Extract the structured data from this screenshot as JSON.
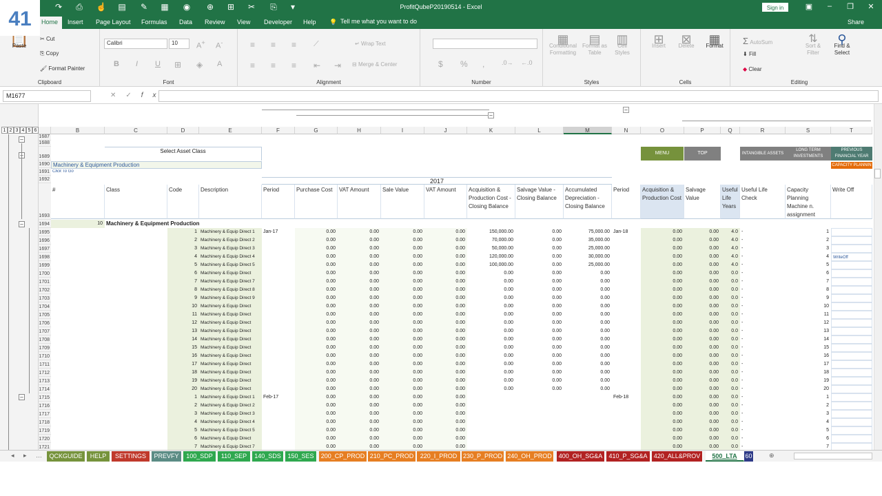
{
  "window": {
    "title": "ProfitQubeP20190514 - Excel",
    "signin": "Sign in"
  },
  "badge": "41",
  "ribbon_tabs": [
    "Home",
    "Insert",
    "Page Layout",
    "Formulas",
    "Data",
    "Review",
    "View",
    "Developer",
    "Help"
  ],
  "tellme": "Tell me what you want to do",
  "share": "Share",
  "ribbon": {
    "clipboard": {
      "label": "Clipboard",
      "paste": "Paste",
      "cut": "Cut",
      "copy": "Copy",
      "format_painter": "Format Painter"
    },
    "font": {
      "label": "Font",
      "family": "Calibri",
      "size": "10",
      "bold": "B",
      "italic": "I",
      "underline": "U"
    },
    "alignment": {
      "label": "Alignment",
      "wrap": "Wrap Text",
      "merge": "Merge & Center"
    },
    "number": {
      "label": "Number",
      "currency": "$",
      "percent": "%"
    },
    "styles": {
      "label": "Styles",
      "cond": "Conditional Formatting",
      "table": "Format as Table",
      "cell": "Cell Styles"
    },
    "cells": {
      "label": "Cells",
      "insert": "Insert",
      "delete": "Delete",
      "format": "Format"
    },
    "editing": {
      "label": "Editing",
      "autosum": "AutoSum",
      "fill": "Fill",
      "clear": "Clear",
      "sort": "Sort & Filter",
      "find": "Find & Select"
    }
  },
  "formula_bar": {
    "name_box": "M1677",
    "value": ""
  },
  "columns": [
    "B",
    "C",
    "D",
    "E",
    "F",
    "G",
    "H",
    "I",
    "J",
    "K",
    "L",
    "M",
    "N",
    "O",
    "P",
    "Q",
    "R",
    "S",
    "T"
  ],
  "outline_levels_v": [
    "1",
    "2",
    "3"
  ],
  "outline_levels_h": [
    "1",
    "2",
    "3",
    "4",
    "5",
    "6"
  ],
  "sheet": {
    "select_asset_class": "Select Asset Class",
    "asset_class": "Machinery & Equipment Production",
    "click_to_go": "Click To Go",
    "year": "2017",
    "buttons": {
      "menu": "MENU",
      "top": "TOP",
      "intangible": "INTANGIBLE ASSETS",
      "long_term": "LONG TERM INVESTMENTS",
      "prev_fy": "PREVIOUS FINANCIAL YEAR",
      "capacity": "CAPACITY PLANNIN"
    },
    "headers": {
      "hash": "#",
      "class": "Class",
      "code": "Code",
      "description": "Description",
      "period": "Period",
      "purchase_cost": "Purchase Cost",
      "vat1": "VAT Amount",
      "sale_value": "Sale Value",
      "vat2": "VAT Amount",
      "acq_closing": "Acquisition & Production Cost - Closing Balance",
      "salvage_closing": "Salvage Value - Closing Balance",
      "accum_dep": "Accumulated Depreciation - Closing Balance",
      "period2": "Period",
      "acq_cost": "Acquisition & Production Cost",
      "salvage": "Salvage Value",
      "useful_life": "Useful Life Years",
      "useful_check": "Useful Life Check",
      "capacity": "Capacity Planning Machine n. assignment",
      "writeoff": "Write Off"
    },
    "group_row": {
      "row": "1694",
      "num": "10",
      "label": "Machinery & Equipment Production"
    },
    "row_numbers_top": [
      "1687",
      "1688",
      "1689",
      "1690",
      "1691",
      "1692",
      "1693"
    ],
    "rows": [
      {
        "r": "1695",
        "code": "1",
        "desc": "Machinery & Equip Direct 1",
        "period": "Jan-17",
        "g": "0.00",
        "h": "0.00",
        "i": "0.00",
        "j": "0.00",
        "k": "150,000.00",
        "l": "0.00",
        "m": "75,000.00",
        "n": "Jan-18",
        "o": "0.00",
        "p": "0.00",
        "q": "4.0",
        "r2": "-",
        "s": "1",
        "t": ""
      },
      {
        "r": "1696",
        "code": "2",
        "desc": "Machinery & Equip Direct 2",
        "period": "",
        "g": "0.00",
        "h": "0.00",
        "i": "0.00",
        "j": "0.00",
        "k": "70,000.00",
        "l": "0.00",
        "m": "35,000.00",
        "n": "",
        "o": "0.00",
        "p": "0.00",
        "q": "4.0",
        "r2": "-",
        "s": "2",
        "t": ""
      },
      {
        "r": "1697",
        "code": "3",
        "desc": "Machinery & Equip Direct 3",
        "period": "",
        "g": "0.00",
        "h": "0.00",
        "i": "0.00",
        "j": "0.00",
        "k": "50,000.00",
        "l": "0.00",
        "m": "25,000.00",
        "n": "",
        "o": "0.00",
        "p": "0.00",
        "q": "4.0",
        "r2": "-",
        "s": "3",
        "t": ""
      },
      {
        "r": "1698",
        "code": "4",
        "desc": "Machinery & Equip Direct 4",
        "period": "",
        "g": "0.00",
        "h": "0.00",
        "i": "0.00",
        "j": "0.00",
        "k": "120,000.00",
        "l": "0.00",
        "m": "30,000.00",
        "n": "",
        "o": "0.00",
        "p": "0.00",
        "q": "4.0",
        "r2": "-",
        "s": "4",
        "t": "WriteOff"
      },
      {
        "r": "1699",
        "code": "5",
        "desc": "Machinery & Equip Direct 5",
        "period": "",
        "g": "0.00",
        "h": "0.00",
        "i": "0.00",
        "j": "0.00",
        "k": "100,000.00",
        "l": "0.00",
        "m": "25,000.00",
        "n": "",
        "o": "0.00",
        "p": "0.00",
        "q": "4.0",
        "r2": "-",
        "s": "5",
        "t": ""
      },
      {
        "r": "1700",
        "code": "6",
        "desc": "Machinery & Equip Direct",
        "period": "",
        "g": "0.00",
        "h": "0.00",
        "i": "0.00",
        "j": "0.00",
        "k": "0.00",
        "l": "0.00",
        "m": "0.00",
        "n": "",
        "o": "0.00",
        "p": "0.00",
        "q": "0.0",
        "r2": "-",
        "s": "6",
        "t": ""
      },
      {
        "r": "1701",
        "code": "7",
        "desc": "Machinery & Equip Direct 7",
        "period": "",
        "g": "0.00",
        "h": "0.00",
        "i": "0.00",
        "j": "0.00",
        "k": "0.00",
        "l": "0.00",
        "m": "0.00",
        "n": "",
        "o": "0.00",
        "p": "0.00",
        "q": "0.0",
        "r2": "-",
        "s": "7",
        "t": ""
      },
      {
        "r": "1702",
        "code": "8",
        "desc": "Machinery & Equip Direct 8",
        "period": "",
        "g": "0.00",
        "h": "0.00",
        "i": "0.00",
        "j": "0.00",
        "k": "0.00",
        "l": "0.00",
        "m": "0.00",
        "n": "",
        "o": "0.00",
        "p": "0.00",
        "q": "0.0",
        "r2": "-",
        "s": "8",
        "t": ""
      },
      {
        "r": "1703",
        "code": "9",
        "desc": "Machinery & Equip Direct 9",
        "period": "",
        "g": "0.00",
        "h": "0.00",
        "i": "0.00",
        "j": "0.00",
        "k": "0.00",
        "l": "0.00",
        "m": "0.00",
        "n": "",
        "o": "0.00",
        "p": "0.00",
        "q": "0.0",
        "r2": "-",
        "s": "9",
        "t": ""
      },
      {
        "r": "1704",
        "code": "10",
        "desc": "Machinery & Equip Direct",
        "period": "",
        "g": "0.00",
        "h": "0.00",
        "i": "0.00",
        "j": "0.00",
        "k": "0.00",
        "l": "0.00",
        "m": "0.00",
        "n": "",
        "o": "0.00",
        "p": "0.00",
        "q": "0.0",
        "r2": "-",
        "s": "10",
        "t": ""
      },
      {
        "r": "1705",
        "code": "11",
        "desc": "Machinery & Equip Direct",
        "period": "",
        "g": "0.00",
        "h": "0.00",
        "i": "0.00",
        "j": "0.00",
        "k": "0.00",
        "l": "0.00",
        "m": "0.00",
        "n": "",
        "o": "0.00",
        "p": "0.00",
        "q": "0.0",
        "r2": "-",
        "s": "11",
        "t": ""
      },
      {
        "r": "1706",
        "code": "12",
        "desc": "Machinery & Equip Direct",
        "period": "",
        "g": "0.00",
        "h": "0.00",
        "i": "0.00",
        "j": "0.00",
        "k": "0.00",
        "l": "0.00",
        "m": "0.00",
        "n": "",
        "o": "0.00",
        "p": "0.00",
        "q": "0.0",
        "r2": "-",
        "s": "12",
        "t": ""
      },
      {
        "r": "1707",
        "code": "13",
        "desc": "Machinery & Equip Direct",
        "period": "",
        "g": "0.00",
        "h": "0.00",
        "i": "0.00",
        "j": "0.00",
        "k": "0.00",
        "l": "0.00",
        "m": "0.00",
        "n": "",
        "o": "0.00",
        "p": "0.00",
        "q": "0.0",
        "r2": "-",
        "s": "13",
        "t": ""
      },
      {
        "r": "1708",
        "code": "14",
        "desc": "Machinery & Equip Direct",
        "period": "",
        "g": "0.00",
        "h": "0.00",
        "i": "0.00",
        "j": "0.00",
        "k": "0.00",
        "l": "0.00",
        "m": "0.00",
        "n": "",
        "o": "0.00",
        "p": "0.00",
        "q": "0.0",
        "r2": "-",
        "s": "14",
        "t": ""
      },
      {
        "r": "1709",
        "code": "15",
        "desc": "Machinery & Equip Direct",
        "period": "",
        "g": "0.00",
        "h": "0.00",
        "i": "0.00",
        "j": "0.00",
        "k": "0.00",
        "l": "0.00",
        "m": "0.00",
        "n": "",
        "o": "0.00",
        "p": "0.00",
        "q": "0.0",
        "r2": "-",
        "s": "15",
        "t": ""
      },
      {
        "r": "1710",
        "code": "16",
        "desc": "Machinery & Equip Direct",
        "period": "",
        "g": "0.00",
        "h": "0.00",
        "i": "0.00",
        "j": "0.00",
        "k": "0.00",
        "l": "0.00",
        "m": "0.00",
        "n": "",
        "o": "0.00",
        "p": "0.00",
        "q": "0.0",
        "r2": "-",
        "s": "16",
        "t": ""
      },
      {
        "r": "1711",
        "code": "17",
        "desc": "Machinery & Equip Direct",
        "period": "",
        "g": "0.00",
        "h": "0.00",
        "i": "0.00",
        "j": "0.00",
        "k": "0.00",
        "l": "0.00",
        "m": "0.00",
        "n": "",
        "o": "0.00",
        "p": "0.00",
        "q": "0.0",
        "r2": "-",
        "s": "17",
        "t": ""
      },
      {
        "r": "1712",
        "code": "18",
        "desc": "Machinery & Equip Direct",
        "period": "",
        "g": "0.00",
        "h": "0.00",
        "i": "0.00",
        "j": "0.00",
        "k": "0.00",
        "l": "0.00",
        "m": "0.00",
        "n": "",
        "o": "0.00",
        "p": "0.00",
        "q": "0.0",
        "r2": "-",
        "s": "18",
        "t": ""
      },
      {
        "r": "1713",
        "code": "19",
        "desc": "Machinery & Equip Direct",
        "period": "",
        "g": "0.00",
        "h": "0.00",
        "i": "0.00",
        "j": "0.00",
        "k": "0.00",
        "l": "0.00",
        "m": "0.00",
        "n": "",
        "o": "0.00",
        "p": "0.00",
        "q": "0.0",
        "r2": "-",
        "s": "19",
        "t": ""
      },
      {
        "r": "1714",
        "code": "20",
        "desc": "Machinery & Equip Direct",
        "period": "",
        "g": "0.00",
        "h": "0.00",
        "i": "0.00",
        "j": "0.00",
        "k": "0.00",
        "l": "0.00",
        "m": "0.00",
        "n": "",
        "o": "0.00",
        "p": "0.00",
        "q": "0.0",
        "r2": "-",
        "s": "20",
        "t": ""
      },
      {
        "r": "1715",
        "code": "1",
        "desc": "Machinery & Equip Direct 1",
        "period": "Feb-17",
        "g": "0.00",
        "h": "0.00",
        "i": "0.00",
        "j": "0.00",
        "k": "",
        "l": "",
        "m": "",
        "n": "Feb-18",
        "o": "0.00",
        "p": "0.00",
        "q": "0.0",
        "r2": "-",
        "s": "1",
        "t": ""
      },
      {
        "r": "1716",
        "code": "2",
        "desc": "Machinery & Equip Direct 2",
        "period": "",
        "g": "0.00",
        "h": "0.00",
        "i": "0.00",
        "j": "0.00",
        "k": "",
        "l": "",
        "m": "",
        "n": "",
        "o": "0.00",
        "p": "0.00",
        "q": "0.0",
        "r2": "-",
        "s": "2",
        "t": ""
      },
      {
        "r": "1717",
        "code": "3",
        "desc": "Machinery & Equip Direct 3",
        "period": "",
        "g": "0.00",
        "h": "0.00",
        "i": "0.00",
        "j": "0.00",
        "k": "",
        "l": "",
        "m": "",
        "n": "",
        "o": "0.00",
        "p": "0.00",
        "q": "0.0",
        "r2": "-",
        "s": "3",
        "t": ""
      },
      {
        "r": "1718",
        "code": "4",
        "desc": "Machinery & Equip Direct 4",
        "period": "",
        "g": "0.00",
        "h": "0.00",
        "i": "0.00",
        "j": "0.00",
        "k": "",
        "l": "",
        "m": "",
        "n": "",
        "o": "0.00",
        "p": "0.00",
        "q": "0.0",
        "r2": "-",
        "s": "4",
        "t": ""
      },
      {
        "r": "1719",
        "code": "5",
        "desc": "Machinery & Equip Direct 5",
        "period": "",
        "g": "0.00",
        "h": "0.00",
        "i": "0.00",
        "j": "0.00",
        "k": "",
        "l": "",
        "m": "",
        "n": "",
        "o": "0.00",
        "p": "0.00",
        "q": "0.0",
        "r2": "-",
        "s": "5",
        "t": ""
      },
      {
        "r": "1720",
        "code": "6",
        "desc": "Machinery & Equip Direct",
        "period": "",
        "g": "0.00",
        "h": "0.00",
        "i": "0.00",
        "j": "0.00",
        "k": "",
        "l": "",
        "m": "",
        "n": "",
        "o": "0.00",
        "p": "0.00",
        "q": "0.0",
        "r2": "-",
        "s": "6",
        "t": ""
      },
      {
        "r": "1721",
        "code": "7",
        "desc": "Machinery & Equip Direct 7",
        "period": "",
        "g": "0.00",
        "h": "0.00",
        "i": "0.00",
        "j": "0.00",
        "k": "",
        "l": "",
        "m": "",
        "n": "",
        "o": "0.00",
        "p": "0.00",
        "q": "0.0",
        "r2": "-",
        "s": "7",
        "t": ""
      }
    ]
  },
  "sheet_tabs": [
    {
      "label": "QCKGUIDE",
      "color": "#76933c"
    },
    {
      "label": "HELP",
      "color": "#76933c"
    },
    {
      "label": "SETTINGS",
      "color": "#c0392b"
    },
    {
      "label": "PREVFY",
      "color": "#5b8c85"
    },
    {
      "label": "100_SDP",
      "color": "#2fa84f"
    },
    {
      "label": "110_SEP",
      "color": "#2fa84f"
    },
    {
      "label": "140_SDS",
      "color": "#2fa84f"
    },
    {
      "label": "150_SES",
      "color": "#2fa84f"
    },
    {
      "label": "200_CP_PROD",
      "color": "#e67e22"
    },
    {
      "label": "210_PC_PROD",
      "color": "#e67e22"
    },
    {
      "label": "220_I_PROD",
      "color": "#e67e22"
    },
    {
      "label": "230_P_PROD",
      "color": "#e67e22"
    },
    {
      "label": "240_OH_PROD",
      "color": "#e67e22"
    },
    {
      "label": "400_OH_SG&A",
      "color": "#b22222"
    },
    {
      "label": "410_P_SG&A",
      "color": "#b22222"
    },
    {
      "label": "420_ALL&PROV",
      "color": "#b22222"
    },
    {
      "label": "500_LTA",
      "color": "#ffffff"
    },
    {
      "label": "60",
      "color": "#2e3a87"
    }
  ]
}
